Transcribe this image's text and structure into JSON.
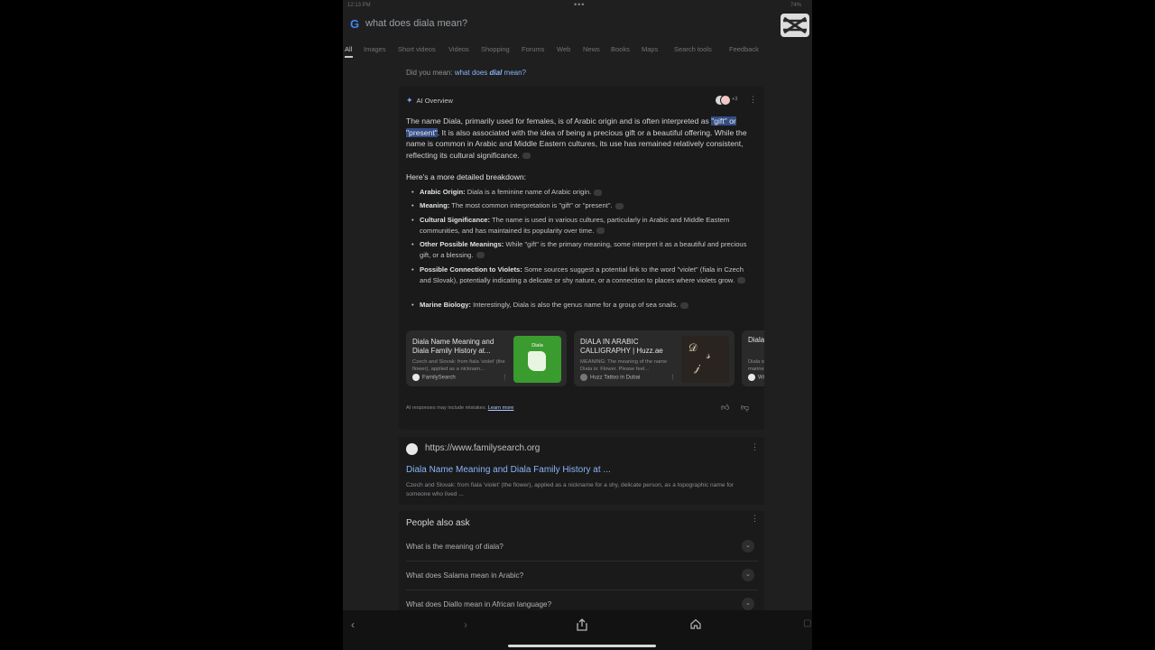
{
  "status": {
    "time": "12:13 PM",
    "battery": "74%"
  },
  "search": {
    "query": "what does diala mean?"
  },
  "tabs": [
    "All",
    "Images",
    "Short videos",
    "Videos",
    "Shopping",
    "Forums",
    "Web",
    "News",
    "Books",
    "Maps",
    "Search tools",
    "Feedback"
  ],
  "did_you_mean": {
    "prefix": "Did you mean:",
    "link_pre": "what does ",
    "link_em": "dial",
    "link_post": " mean?"
  },
  "ai_overview": {
    "label": "AI Overview",
    "avatars_more": "+3",
    "intro_1": "The name Diala, primarily used for females, is of Arabic origin and is often interpreted as ",
    "intro_hl": "\"gift\" or \"present\"",
    "intro_2": ". It is also associated with the idea of being a precious gift or a beautiful offering. While the name is common in Arabic and Middle Eastern cultures, its use has remained relatively consistent, reflecting its cultural significance.",
    "breakdown_heading": "Here's a more detailed breakdown:",
    "bullets": [
      {
        "label": "Arabic Origin:",
        "text": " Diala is a feminine name of Arabic origin."
      },
      {
        "label": "Meaning:",
        "text": " The most common interpretation is \"gift\" or \"present\"."
      },
      {
        "label": "Cultural Significance:",
        "text": " The name is used in various cultures, particularly in Arabic and Middle Eastern communities, and has maintained its popularity over time."
      },
      {
        "label": "Other Possible Meanings:",
        "text": " While \"gift\" is the primary meaning, some interpret it as a beautiful and precious gift, or a blessing."
      },
      {
        "label": "Possible Connection to Violets:",
        "text": " Some sources suggest a potential link to the word \"violet\" (fiala in Czech and Slovak), potentially indicating a delicate or shy nature, or a connection to places where violets grow."
      },
      {
        "label": "Marine Biology:",
        "text": " Interestingly, Diala is also the genus name for a group of sea snails."
      }
    ],
    "sources": [
      {
        "title": "Diala Name Meaning and Diala Family History at...",
        "snippet": "Czech and Slovak: from fiala 'violet' (the flower), applied as a nicknam...",
        "site": "FamilySearch",
        "thumb_label": "Diala"
      },
      {
        "title": "DIALA IN ARABIC CALLIGRAPHY | Huzz.ae",
        "snippet": "MEANING: The meaning of the name Diala is: Flower. Please feel...",
        "site": "Huzz Tattoo in Dubai"
      },
      {
        "title": "Diala",
        "snippet": "Diala is marine...",
        "site": "Wi"
      }
    ],
    "disclaimer": "AI responses may include mistakes.",
    "learn_more": "Learn more"
  },
  "result": {
    "url": "https://www.familysearch.org",
    "title": "Diala Name Meaning and Diala Family History at ...",
    "snippet": "Czech and Slovak: from fiala 'violet' (the flower), applied as a nickname for a shy, delicate person, as a topographic name for someone who lived ..."
  },
  "people_also_ask": {
    "heading": "People also ask",
    "questions": [
      "What is the meaning of diala?",
      "What does Salama mean in Arabic?",
      "What does Diallo mean in African language?"
    ]
  },
  "colors": {
    "background": "#1f1f1f",
    "card": "#1a1a1a",
    "link": "#8ab4f8",
    "highlight": "#344d86"
  }
}
